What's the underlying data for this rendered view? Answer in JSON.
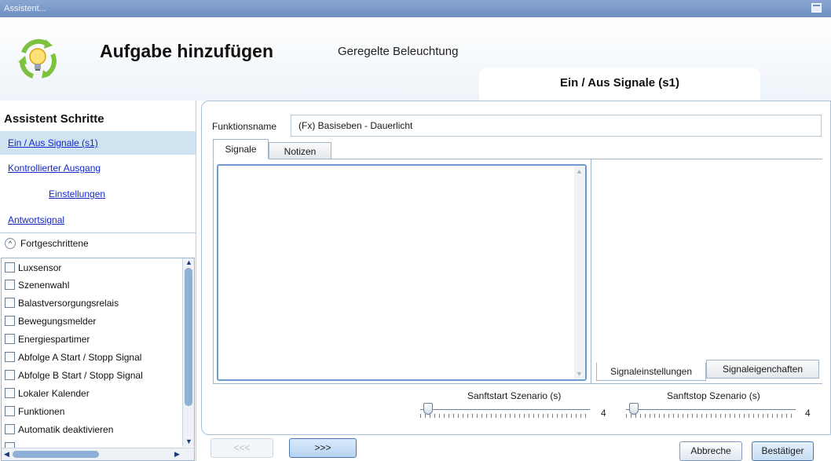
{
  "window": {
    "title": "Assistent..."
  },
  "header": {
    "title": "Aufgabe hinzufügen",
    "subtitle": "Geregelte Beleuchtung",
    "current_step": "Ein / Aus Signale (s1)"
  },
  "sidebar": {
    "title": "Assistent Schritte",
    "steps": [
      {
        "label": "Ein / Aus Signale (s1)"
      },
      {
        "label": "Kontrollierter Ausgang"
      },
      {
        "label": "Einstellungen"
      },
      {
        "label": "Antwortsignal"
      }
    ],
    "advanced": {
      "label": "Fortgeschrittene",
      "items": [
        {
          "label": "Luxsensor",
          "checked": false
        },
        {
          "label": "Szenenwahl",
          "checked": false
        },
        {
          "label": "Balastversorgungsrelais",
          "checked": false
        },
        {
          "label": "Bewegungsmelder",
          "checked": false
        },
        {
          "label": "Energiespartimer",
          "checked": false
        },
        {
          "label": "Abfolge A Start / Stopp Signal",
          "checked": false
        },
        {
          "label": "Abfolge B Start / Stopp Signal",
          "checked": false
        },
        {
          "label": "Lokaler Kalender",
          "checked": false
        },
        {
          "label": "Funktionen",
          "checked": false
        },
        {
          "label": "Automatik deaktivieren",
          "checked": false
        }
      ]
    }
  },
  "main": {
    "function_name_label": "Funktionsname",
    "function_name_value": "(Fx) Basiseben - Dauerlicht",
    "tabs": [
      {
        "label": "Signale",
        "active": true
      },
      {
        "label": "Notizen",
        "active": false
      }
    ],
    "detail_tabs": [
      {
        "label": "Signaleinstellungen",
        "active": true
      },
      {
        "label": "Signaleigenchaften",
        "active": false
      }
    ],
    "soft_start": {
      "label": "Sanftstart Szenario (s)",
      "value": "4"
    },
    "soft_stop": {
      "label": "Sanftstop Szenario (s)",
      "value": "4"
    }
  },
  "footer": {
    "prev_label": "<<<",
    "next_label": ">>>",
    "cancel_label": "Abbreche",
    "confirm_label": "Bestätiger"
  },
  "colors": {
    "titlebar": "#7b98c9",
    "accent": "#4c76ad",
    "active_step_bg": "#cfe3f0",
    "link": "#1428c8"
  }
}
